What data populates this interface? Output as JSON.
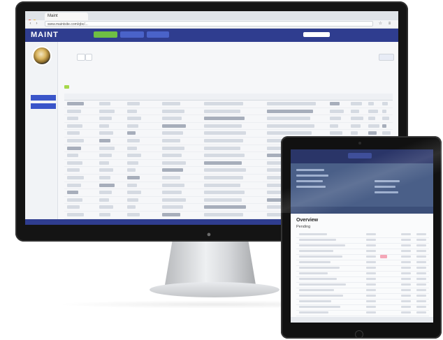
{
  "monitor": {
    "apple_logo_icon": "apple-logo-icon",
    "browser": {
      "tab_title": "Maint",
      "url": "www.maintsite.com/qbc/...",
      "nav_back": "‹",
      "nav_forward": "›",
      "window_dot_colors": [
        "#e9574a",
        "#f1b83b",
        "#58b94c"
      ]
    },
    "app": {
      "logo_main": "MAINT",
      "logo_suffix": "",
      "header_buttons": [
        {
          "label": "",
          "color": "#6fbf44"
        },
        {
          "label": "",
          "color": "#4a63c9"
        },
        {
          "label": "",
          "color": "#4a63c9"
        }
      ],
      "user_label": "",
      "accent_color": "#2f3d8f",
      "active_color": "#3a55c9"
    },
    "sidebar": {
      "items": [
        {
          "label": "",
          "active": false
        },
        {
          "label": "",
          "active": false
        },
        {
          "label": "",
          "active": false
        },
        {
          "label": "",
          "active": true
        },
        {
          "label": "",
          "active": true
        },
        {
          "label": "",
          "active": false
        },
        {
          "label": "",
          "active": false
        },
        {
          "label": "",
          "active": false
        },
        {
          "label": "",
          "active": false
        },
        {
          "label": "",
          "active": false
        },
        {
          "label": "",
          "active": false
        },
        {
          "label": "",
          "active": false
        },
        {
          "label": "",
          "active": false
        },
        {
          "label": "",
          "active": false
        },
        {
          "label": "",
          "active": false
        }
      ]
    },
    "main": {
      "title": ""
    }
  },
  "tablet": {
    "section_title": "Overview",
    "section_subtitle": "Pending"
  }
}
